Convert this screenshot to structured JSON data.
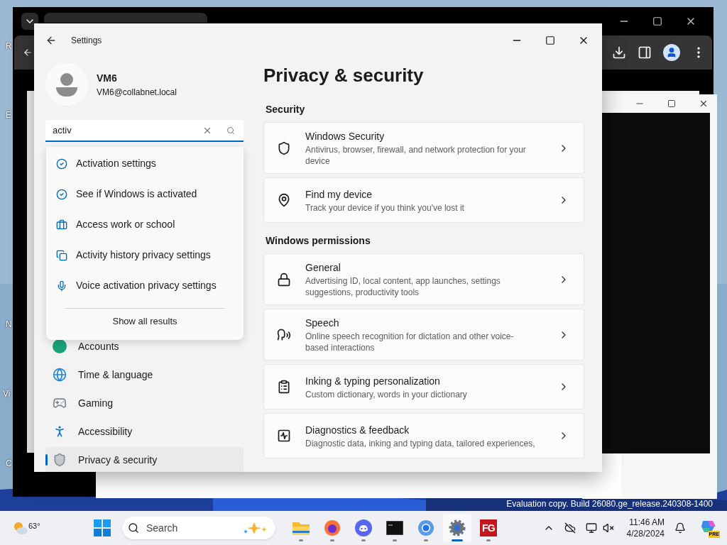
{
  "desktop": {
    "icon_labels": [
      "R",
      "E",
      "N",
      "Vi",
      "C"
    ],
    "notice": "Evaluation copy. Build 26080.ge_release.240308-1400"
  },
  "settings_window": {
    "title": "Settings",
    "profile": {
      "name": "VM6",
      "email": "VM6@collabnet.local"
    },
    "search": {
      "value": "activ"
    },
    "results": [
      {
        "kind": "check",
        "label": "Activation settings"
      },
      {
        "kind": "check",
        "label": "See if Windows is activated"
      },
      {
        "kind": "briefcase",
        "label": "Access work or school"
      },
      {
        "kind": "history",
        "label": "Activity history privacy settings"
      },
      {
        "kind": "mic",
        "label": "Voice activation privacy settings"
      }
    ],
    "show_all": "Show all results",
    "nav": [
      {
        "kind": "accounts",
        "label": "Accounts",
        "selected": false
      },
      {
        "kind": "time",
        "label": "Time & language",
        "selected": false
      },
      {
        "kind": "gaming",
        "label": "Gaming",
        "selected": false
      },
      {
        "kind": "accessibility",
        "label": "Accessibility",
        "selected": false
      },
      {
        "kind": "privacy",
        "label": "Privacy & security",
        "selected": true
      }
    ],
    "heading": "Privacy & security",
    "sections": [
      {
        "title": "Security",
        "cards": [
          {
            "kind": "shield",
            "title": "Windows Security",
            "description": "Antivirus, browser, firewall, and network protection for your device"
          },
          {
            "kind": "locate",
            "title": "Find my device",
            "description": "Track your device if you think you've lost it"
          }
        ]
      },
      {
        "title": "Windows permissions",
        "cards": [
          {
            "kind": "lock",
            "title": "General",
            "description": "Advertising ID, local content, app launches, settings suggestions, productivity tools"
          },
          {
            "kind": "speech",
            "title": "Speech",
            "description": "Online speech recognition for dictation and other voice-based interactions"
          },
          {
            "kind": "clipboard",
            "title": "Inking & typing personalization",
            "description": "Custom dictionary, words in your dictionary"
          },
          {
            "kind": "activity",
            "title": "Diagnostics & feedback",
            "description": "Diagnostic data, inking and typing data, tailored experiences,"
          }
        ]
      }
    ]
  },
  "taskbar": {
    "weather": "63°",
    "search_placeholder": "Search",
    "apps": [
      {
        "kind": "folder",
        "selected": false
      },
      {
        "kind": "firefox",
        "selected": false
      },
      {
        "kind": "discord",
        "selected": false
      },
      {
        "kind": "terminal",
        "selected": false
      },
      {
        "kind": "chrome",
        "selected": false
      },
      {
        "kind": "settings",
        "selected": true
      },
      {
        "kind": "fg",
        "selected": false
      }
    ],
    "app_fg_label": "FG",
    "time": "11:46 AM",
    "date": "4/28/2024",
    "copilot_badge": "PRE"
  }
}
